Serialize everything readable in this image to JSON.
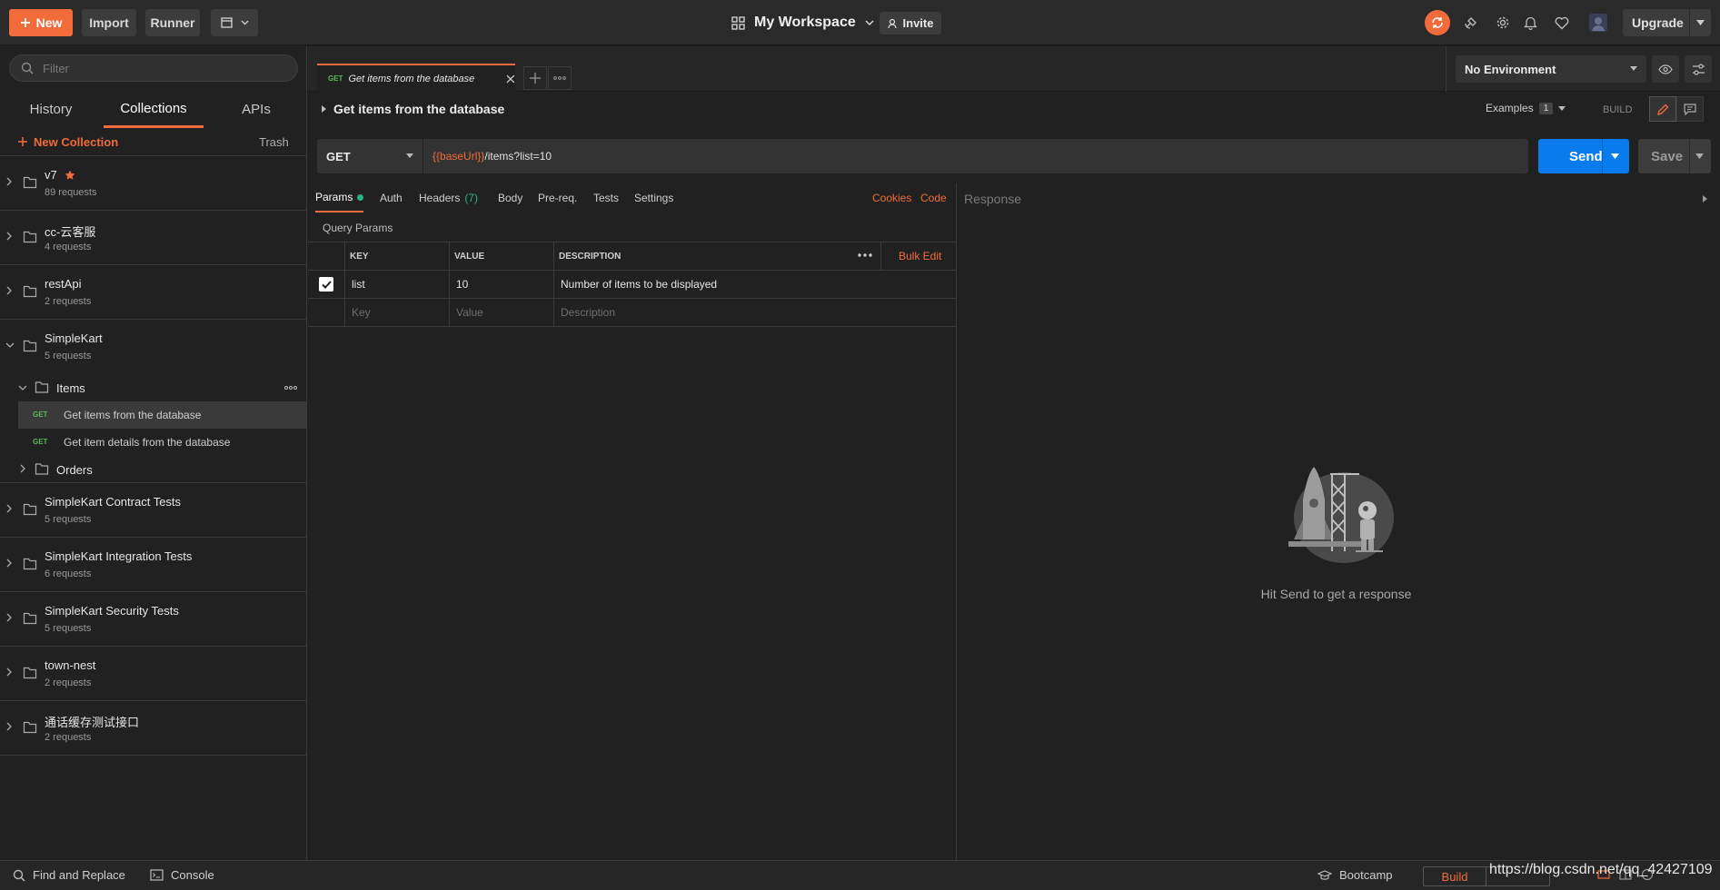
{
  "header": {
    "new_label": "New",
    "import_label": "Import",
    "runner_label": "Runner",
    "workspace_label": "My Workspace",
    "invite_label": "Invite",
    "upgrade_label": "Upgrade"
  },
  "sidebar": {
    "filter_placeholder": "Filter",
    "tabs": [
      "History",
      "Collections",
      "APIs"
    ],
    "new_collection_label": "New Collection",
    "trash_label": "Trash",
    "collections": [
      {
        "name": "v7",
        "count": "89 requests"
      },
      {
        "name": "cc-云客服",
        "count": "4 requests"
      },
      {
        "name": "restApi",
        "count": "2 requests"
      },
      {
        "name": "SimpleKart",
        "count": "5 requests"
      },
      {
        "name": "SimpleKart Contract Tests",
        "count": "5 requests"
      },
      {
        "name": "SimpleKart Integration Tests",
        "count": "6 requests"
      },
      {
        "name": "SimpleKart Security Tests",
        "count": "5 requests"
      },
      {
        "name": "town-nest",
        "count": "2 requests"
      },
      {
        "name": "通话缓存测试接口",
        "count": "2 requests"
      }
    ],
    "folders": [
      {
        "name": "Items"
      },
      {
        "name": "Orders"
      }
    ],
    "requests": [
      {
        "method": "GET",
        "name": "Get items from the database"
      },
      {
        "method": "GET",
        "name": "Get item details from the database"
      }
    ]
  },
  "tabbar": {
    "tab_method": "GET",
    "tab_title": "Get items from the database",
    "environment": "No Environment"
  },
  "request": {
    "title": "Get items from the database",
    "examples_label": "Examples",
    "examples_count": "1",
    "build_label": "BUILD",
    "method": "GET",
    "url_var": "{{baseUrl}}",
    "url_path": "/items?list=10",
    "send_label": "Send",
    "save_label": "Save",
    "tabs": {
      "params": "Params",
      "auth": "Auth",
      "headers": "Headers",
      "headers_count": "(7)",
      "body": "Body",
      "prereq": "Pre-req.",
      "tests": "Tests",
      "settings": "Settings"
    },
    "cookies_label": "Cookies",
    "code_label": "Code",
    "query_params_label": "Query Params",
    "columns": {
      "key": "KEY",
      "value": "VALUE",
      "description": "DESCRIPTION"
    },
    "bulk_edit_label": "Bulk Edit",
    "params": [
      {
        "key": "list",
        "value": "10",
        "description": "Number of items to be displayed"
      }
    ],
    "placeholders": {
      "key": "Key",
      "value": "Value",
      "description": "Description"
    }
  },
  "response": {
    "label": "Response",
    "hint": "Hit Send to get a response"
  },
  "statusbar": {
    "find_replace_label": "Find and Replace",
    "console_label": "Console",
    "bootcamp_label": "Bootcamp",
    "build_label": "Build",
    "watermark": "https://blog.csdn.net/qq_42427109"
  },
  "colors": {
    "accent": "#f26b3a",
    "send": "#097bed",
    "get_method": "#5ab85c",
    "success_dot": "#26b47f"
  }
}
